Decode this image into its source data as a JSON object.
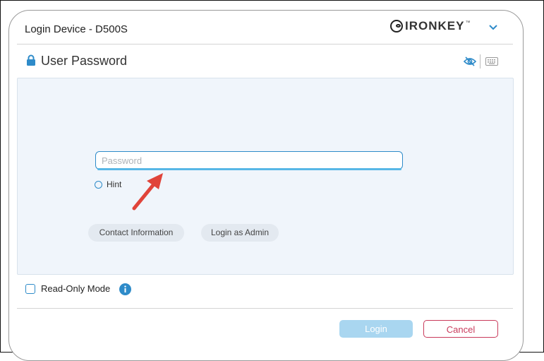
{
  "window": {
    "title": "Login Device - D500S"
  },
  "brand": {
    "name": "IRONKEY",
    "trademark": "™"
  },
  "section": {
    "title": "User Password"
  },
  "password": {
    "placeholder": "Password"
  },
  "hint": {
    "label": "Hint"
  },
  "links": {
    "contact": "Contact Information",
    "admin": "Login as Admin"
  },
  "readonly": {
    "label": "Read-Only Mode"
  },
  "buttons": {
    "login": "Login",
    "cancel": "Cancel"
  },
  "colors": {
    "accent": "#2e8bc9",
    "cancel": "#c93a5b",
    "login_disabled": "#a9d6f0",
    "annotation_arrow": "#e0443a"
  },
  "icons": [
    "ironkey-logo-icon",
    "chevron-down-icon",
    "lock-icon",
    "eye-off-icon",
    "keyboard-icon",
    "info-icon",
    "red-arrow-annotation"
  ]
}
